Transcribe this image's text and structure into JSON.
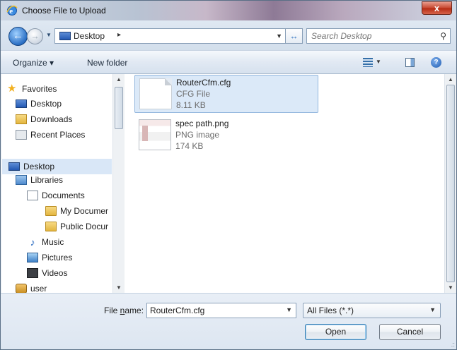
{
  "window": {
    "title": "Choose File to Upload",
    "close_symbol": "x",
    "app_icon": "ie-icon"
  },
  "address": {
    "location": "Desktop",
    "separator": "▸",
    "search_placeholder": "Search Desktop"
  },
  "toolbar": {
    "organize": "Organize ▾",
    "new_folder": "New folder"
  },
  "nav": {
    "favorites": "Favorites",
    "fav_desktop": "Desktop",
    "downloads": "Downloads",
    "recent_places": "Recent Places",
    "desktop": "Desktop",
    "libraries": "Libraries",
    "documents": "Documents",
    "my_documents": "My Documer",
    "public_documents": "Public Docur",
    "music": "Music",
    "pictures": "Pictures",
    "videos": "Videos",
    "user": "user"
  },
  "files": [
    {
      "name": "RouterCfm.cfg",
      "type": "CFG File",
      "size": "8.11 KB",
      "selected": true
    },
    {
      "name": "spec path.png",
      "type": "PNG image",
      "size": "174 KB",
      "selected": false
    }
  ],
  "bottom": {
    "file_name_label_pre": "File ",
    "file_name_label_u": "n",
    "file_name_label_post": "ame:",
    "file_name_value": "RouterCfm.cfg",
    "file_type": "All Files (*.*)",
    "open": "Open",
    "cancel": "Cancel"
  },
  "colors": {
    "selection": "#dbe9f8",
    "accent": "#2a6fc4"
  }
}
